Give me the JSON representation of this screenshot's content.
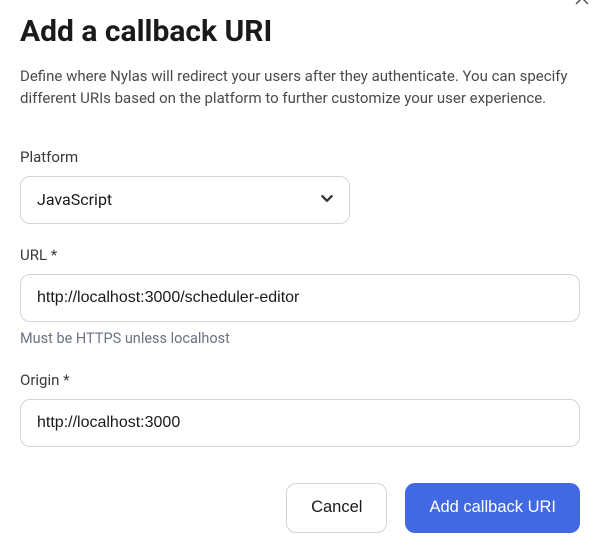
{
  "dialog": {
    "title": "Add a callback URI",
    "description": "Define where Nylas will redirect your users after they authenticate. You can specify different URIs based on the platform to further customize your user experience.",
    "fields": {
      "platform": {
        "label": "Platform",
        "value": "JavaScript"
      },
      "url": {
        "label": "URL *",
        "value": "http://localhost:3000/scheduler-editor",
        "help": "Must be HTTPS unless localhost"
      },
      "origin": {
        "label": "Origin *",
        "value": "http://localhost:3000"
      }
    },
    "actions": {
      "cancel": "Cancel",
      "submit": "Add callback URI"
    }
  }
}
